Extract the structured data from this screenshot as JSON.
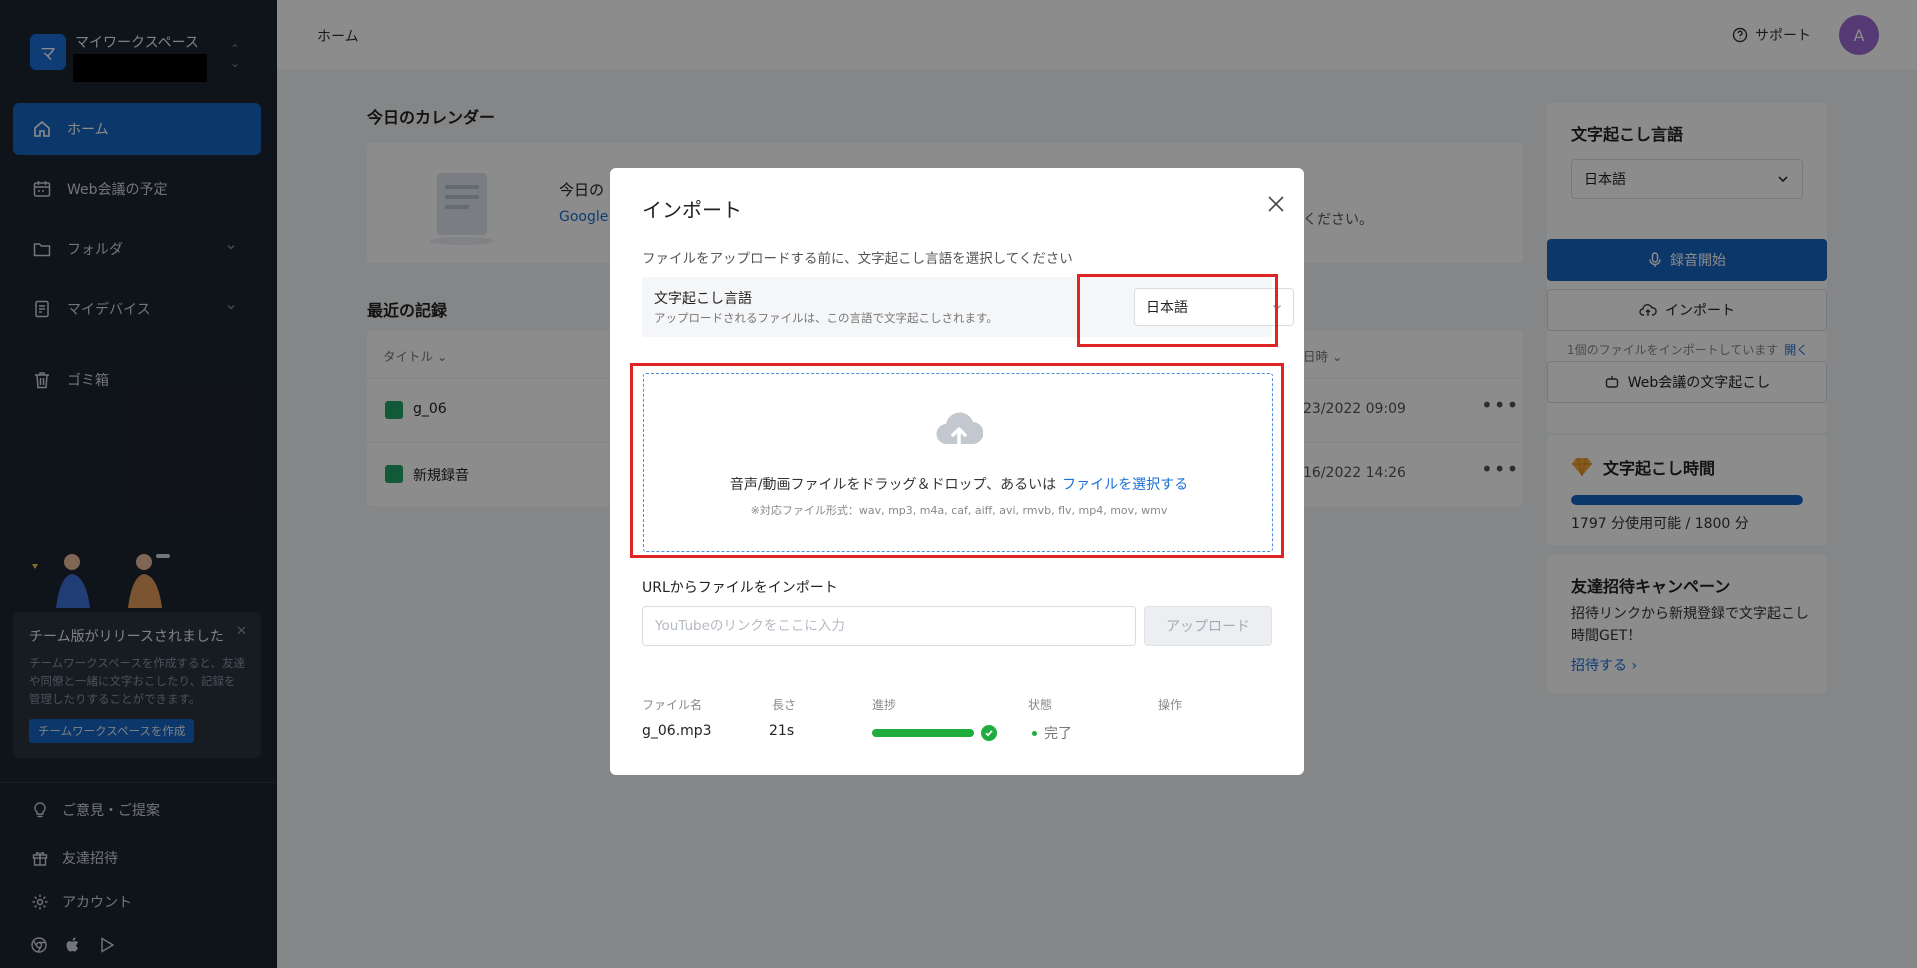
{
  "sidebar": {
    "workspace": {
      "initial": "マ",
      "name": "マイワークスペース"
    },
    "nav": [
      {
        "label": "ホーム"
      },
      {
        "label": "Web会議の予定"
      },
      {
        "label": "フォルダ"
      },
      {
        "label": "マイデバイス"
      },
      {
        "label": "ゴミ箱"
      }
    ],
    "promo": {
      "title": "チーム版がリリースされました",
      "text": "チームワークスペースを作成すると、友達や同僚と一緒に文字おこしたり、記録を管理したりすることができます。",
      "button": "チームワークスペースを作成"
    },
    "footer": [
      {
        "label": "ご意見・ご提案"
      },
      {
        "label": "友達招待"
      },
      {
        "label": "アカウント"
      }
    ]
  },
  "topbar": {
    "breadcrumb": "ホーム",
    "support": "サポート",
    "avatar": "A"
  },
  "main": {
    "calendar_title": "今日のカレンダー",
    "calendar_text1": "今日の",
    "calendar_link": "Google",
    "calendar_text2": "ください。",
    "recent_title": "最近の記録",
    "table_col_title": "タイトル",
    "table_col_date": "日時",
    "rows": [
      {
        "name": "g_06",
        "date": "23/2022 09:09"
      },
      {
        "name": "新規録音",
        "date": "16/2022 14:26"
      }
    ]
  },
  "right_panel": {
    "lang_title": "文字起こし言語",
    "lang_value": "日本語",
    "record_button": "録音開始",
    "import_button": "インポート",
    "import_note": "1個のファイルをインポートしています",
    "import_note_link": "開く",
    "web_button": "Web会議の文字起こし",
    "time_title": "文字起こし時間",
    "time_usage": "1797 分使用可能 / 1800 分",
    "time_fraction": 0.998,
    "invite_title": "友達招待キャンペーン",
    "invite_text": "招待リンクから新規登録で文字起こし時間GET！",
    "invite_link": "招待する ›"
  },
  "modal": {
    "title": "インポート",
    "subtitle": "ファイルをアップロードする前に、文字起こし言語を選択してください",
    "lang_label": "文字起こし言語",
    "lang_desc": "アップロードされるファイルは、この言語で文字起こしされます。",
    "lang_value": "日本語",
    "drop_text": "音声/動画ファイルをドラッグ＆ドロップ、あるいは",
    "drop_link": "ファイルを選択する",
    "formats": "※対応ファイル形式：wav, mp3, m4a, caf, aiff, avi, rmvb, flv, mp4, mov, wmv",
    "url_title": "URLからファイルをインポート",
    "url_placeholder": "YouTubeのリンクをここに入力",
    "upload_button": "アップロード",
    "table_headers": {
      "name": "ファイル名",
      "length": "長さ",
      "progress": "進捗",
      "status": "状態",
      "action": "操作"
    },
    "file": {
      "name": "g_06.mp3",
      "length": "21s",
      "progress": 1.0,
      "status": "完了"
    }
  },
  "colors": {
    "accent": "#1764c2",
    "success": "#1fad3e",
    "highlight": "#e02424"
  }
}
